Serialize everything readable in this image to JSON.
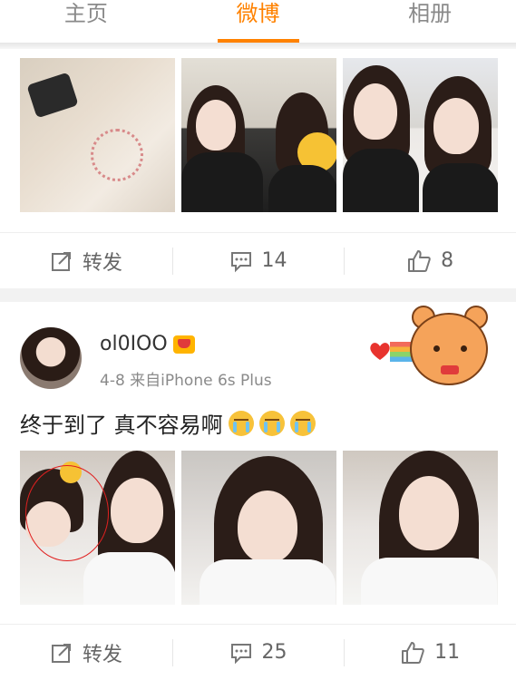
{
  "tabs": [
    {
      "label": "主页",
      "active": false
    },
    {
      "label": "微博",
      "active": true
    },
    {
      "label": "相册",
      "active": false
    }
  ],
  "accent_color": "#ff8200",
  "post1": {
    "actions": {
      "repost_label": "转发",
      "comment_count": "14",
      "like_count": "8"
    }
  },
  "post2": {
    "username": "ol0IOO",
    "meta": "4-8 来自iPhone 6s Plus",
    "text": "终于到了 真不容易啊",
    "text_emoji": "cry-emoji",
    "actions": {
      "repost_label": "转发",
      "comment_count": "25",
      "like_count": "11"
    }
  },
  "icons": {
    "repost": "share-icon",
    "comment": "comment-icon",
    "like": "thumbs-up-icon",
    "verified": "vip-crown-icon"
  }
}
